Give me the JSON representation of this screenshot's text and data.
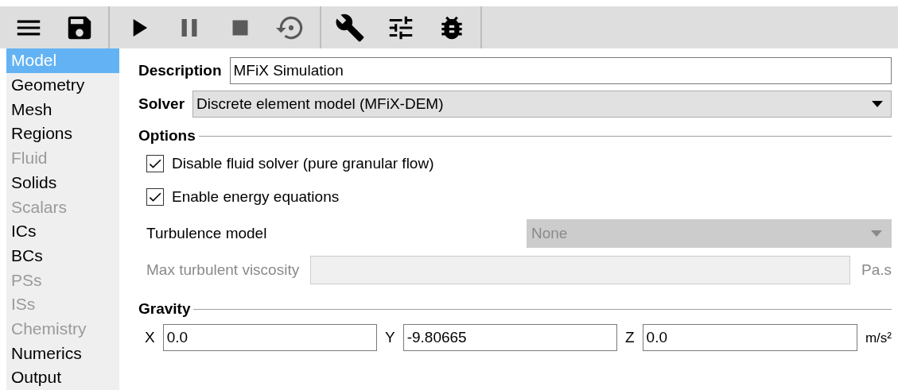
{
  "toolbar": {
    "groups": [
      {
        "buttons": [
          {
            "kind": "menu",
            "disabled": false
          },
          {
            "kind": "save",
            "disabled": false
          }
        ]
      },
      {
        "buttons": [
          {
            "kind": "play",
            "disabled": false
          },
          {
            "kind": "pause",
            "disabled": true
          },
          {
            "kind": "stop",
            "disabled": true
          },
          {
            "kind": "reset",
            "disabled": true
          }
        ]
      },
      {
        "buttons": [
          {
            "kind": "wrench",
            "disabled": false
          },
          {
            "kind": "sliders",
            "disabled": false
          },
          {
            "kind": "bug",
            "disabled": false
          }
        ]
      }
    ]
  },
  "sidebar": {
    "items": [
      {
        "label": "Model",
        "selected": true,
        "disabled": false
      },
      {
        "label": "Geometry",
        "selected": false,
        "disabled": false
      },
      {
        "label": "Mesh",
        "selected": false,
        "disabled": false
      },
      {
        "label": "Regions",
        "selected": false,
        "disabled": false
      },
      {
        "label": "Fluid",
        "selected": false,
        "disabled": true
      },
      {
        "label": "Solids",
        "selected": false,
        "disabled": false
      },
      {
        "label": "Scalars",
        "selected": false,
        "disabled": true
      },
      {
        "label": "ICs",
        "selected": false,
        "disabled": false
      },
      {
        "label": "BCs",
        "selected": false,
        "disabled": false
      },
      {
        "label": "PSs",
        "selected": false,
        "disabled": true
      },
      {
        "label": "ISs",
        "selected": false,
        "disabled": true
      },
      {
        "label": "Chemistry",
        "selected": false,
        "disabled": true
      },
      {
        "label": "Numerics",
        "selected": false,
        "disabled": false
      },
      {
        "label": "Output",
        "selected": false,
        "disabled": false
      }
    ]
  },
  "description": {
    "label": "Description",
    "value": "MFiX Simulation"
  },
  "solver": {
    "label": "Solver",
    "value": "Discrete element model (MFiX-DEM)"
  },
  "options": {
    "title": "Options",
    "checkboxes": [
      {
        "label": "Disable fluid solver (pure granular flow)",
        "checked": true
      },
      {
        "label": "Enable energy equations",
        "checked": true
      }
    ],
    "turbulence_model": {
      "label": "Turbulence model",
      "value": "None",
      "disabled": true
    },
    "max_turbulent_viscosity": {
      "label": "Max turbulent viscosity",
      "unit": "Pa.s",
      "disabled": true
    }
  },
  "gravity": {
    "title": "Gravity",
    "fields": [
      {
        "label": "X",
        "value": "0.0"
      },
      {
        "label": "Y",
        "value": "-9.80665"
      },
      {
        "label": "Z",
        "value": "0.0"
      }
    ],
    "unit": "m/s²"
  }
}
